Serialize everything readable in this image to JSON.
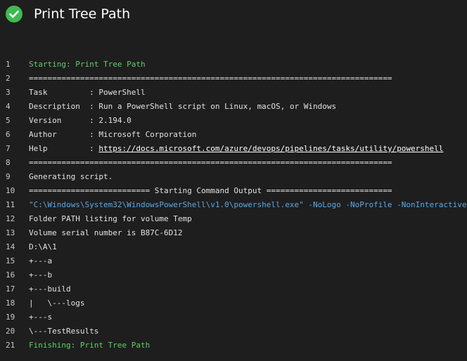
{
  "header": {
    "title": "Print Tree Path",
    "status_icon": "check-circle-icon",
    "status_color": "#3fb950"
  },
  "colors": {
    "section": "#5fcf65",
    "command": "#5aa9e6",
    "text": "#e2e2e2"
  },
  "log": {
    "lines": [
      {
        "no": "1",
        "text": "Starting: Print Tree Path",
        "kind": "section"
      },
      {
        "no": "2",
        "text": "==============================================================================",
        "kind": "plain"
      },
      {
        "no": "3",
        "text": "Task         : PowerShell",
        "kind": "plain"
      },
      {
        "no": "4",
        "text": "Description  : Run a PowerShell script on Linux, macOS, or Windows",
        "kind": "plain"
      },
      {
        "no": "5",
        "text": "Version      : 2.194.0",
        "kind": "plain"
      },
      {
        "no": "6",
        "text": "Author       : Microsoft Corporation",
        "kind": "plain"
      },
      {
        "no": "7",
        "text": "Help         : ",
        "link": "https://docs.microsoft.com/azure/devops/pipelines/tasks/utility/powershell",
        "kind": "link"
      },
      {
        "no": "8",
        "text": "==============================================================================",
        "kind": "plain"
      },
      {
        "no": "9",
        "text": "Generating script.",
        "kind": "plain"
      },
      {
        "no": "10",
        "text": "========================== Starting Command Output ===========================",
        "kind": "plain"
      },
      {
        "no": "11",
        "text": "\"C:\\Windows\\System32\\WindowsPowerShell\\v1.0\\powershell.exe\" -NoLogo -NoProfile -NonInteractive",
        "kind": "command"
      },
      {
        "no": "12",
        "text": "Folder PATH listing for volume Temp",
        "kind": "plain"
      },
      {
        "no": "13",
        "text": "Volume serial number is B87C-6D12",
        "kind": "plain"
      },
      {
        "no": "14",
        "text": "D:\\A\\1",
        "kind": "plain"
      },
      {
        "no": "15",
        "text": "+---a",
        "kind": "plain"
      },
      {
        "no": "16",
        "text": "+---b",
        "kind": "plain"
      },
      {
        "no": "17",
        "text": "+---build",
        "kind": "plain"
      },
      {
        "no": "18",
        "text": "|   \\---logs",
        "kind": "plain"
      },
      {
        "no": "19",
        "text": "+---s",
        "kind": "plain"
      },
      {
        "no": "20",
        "text": "\\---TestResults",
        "kind": "plain"
      },
      {
        "no": "21",
        "text": "Finishing: Print Tree Path",
        "kind": "section"
      }
    ]
  }
}
